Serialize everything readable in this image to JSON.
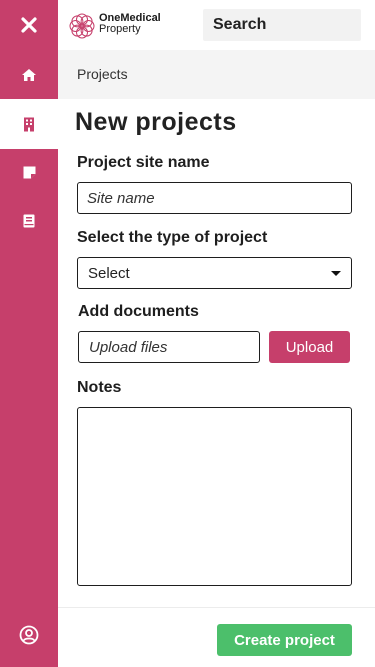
{
  "brand": {
    "line1": "OneMedical",
    "line2": "Property"
  },
  "search": {
    "placeholder": "Search"
  },
  "sidebar": {
    "items": [
      {
        "icon": "close-icon"
      },
      {
        "icon": "home-icon"
      },
      {
        "icon": "building-icon",
        "active": true
      },
      {
        "icon": "note-icon"
      },
      {
        "icon": "book-icon"
      },
      {
        "icon": "user-circle-icon"
      }
    ]
  },
  "breadcrumb": {
    "label": "Projects"
  },
  "page": {
    "title": "New projects"
  },
  "form": {
    "site_name": {
      "label": "Project site name",
      "placeholder": "Site name"
    },
    "project_type": {
      "label": "Select the type of project",
      "value": "Select"
    },
    "documents": {
      "label": "Add documents",
      "placeholder": "Upload files",
      "button": "Upload"
    },
    "notes": {
      "label": "Notes"
    },
    "submit": "Create project"
  },
  "colors": {
    "accent": "#c63f6b",
    "success": "#4cbf6b"
  }
}
